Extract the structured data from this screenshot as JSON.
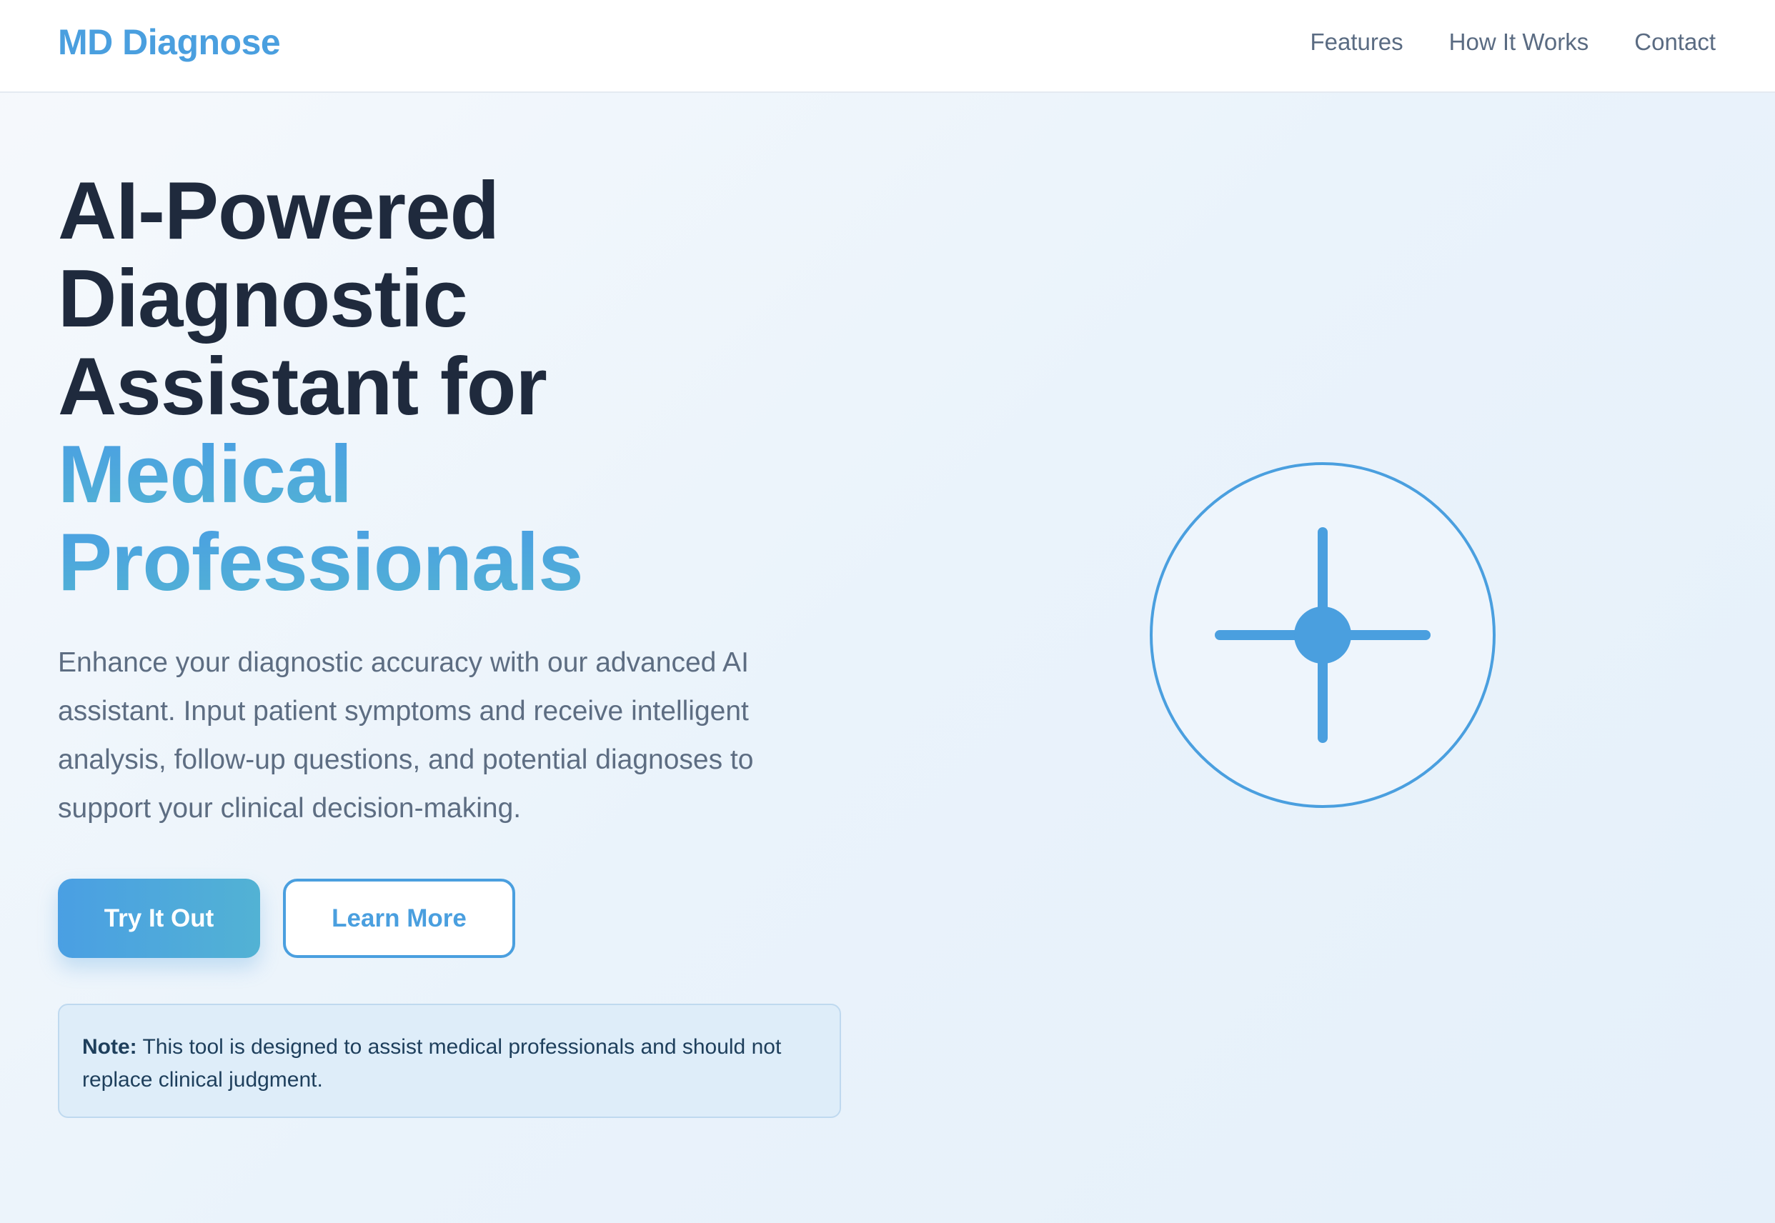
{
  "header": {
    "brand": "MD Diagnose",
    "nav": [
      "Features",
      "How It Works",
      "Contact"
    ]
  },
  "hero": {
    "title_lines": [
      "AI-Powered",
      "Diagnostic",
      "Assistant for"
    ],
    "title_accent_lines": [
      "Medical",
      "Professionals"
    ],
    "description": "Enhance your diagnostic accuracy with our advanced AI assistant. Input patient symptoms and receive intelligent analysis, follow-up questions, and potential diagnoses to support your clinical decision-making.",
    "primary_button": "Try It Out",
    "secondary_button": "Learn More",
    "note_label": "Note:",
    "note_text": " This tool is designed to assist medical professionals and should not replace clinical judgment."
  },
  "illustration": {
    "icon": "medical-crosshair-icon"
  },
  "colors": {
    "accent": "#4a9fdf",
    "accent_teal": "#52b2d4",
    "heading": "#1f2a3d",
    "body_text": "#5d6d82",
    "nav_text": "#5a6b82",
    "note_bg": "#deedf9",
    "note_border": "#bfd9ef"
  }
}
